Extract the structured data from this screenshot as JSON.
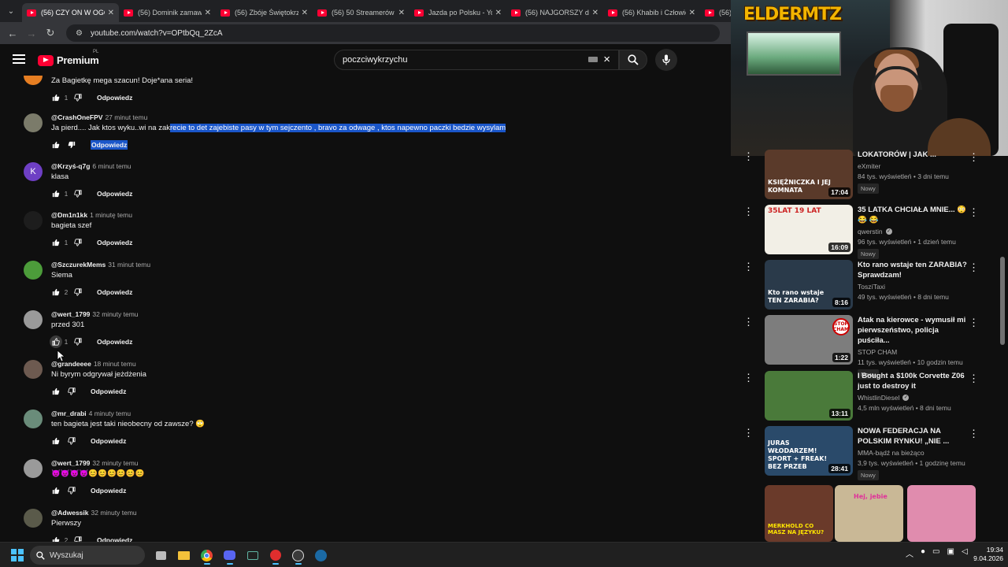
{
  "browser": {
    "tabs": [
      {
        "title": "(56) CZY ON W OGÓ",
        "active": true
      },
      {
        "title": "(56) Dominik zamaw",
        "active": false
      },
      {
        "title": "(56) Zbóje Świętokrzy",
        "active": false
      },
      {
        "title": "(56) 50 Streamerów W",
        "active": false
      },
      {
        "title": "Jazda po Polsku - You",
        "active": false
      },
      {
        "title": "(56) NAJGORSZY dzi",
        "active": false
      },
      {
        "title": "(56) Khabib i Człowie",
        "active": false
      },
      {
        "title": "(56) ",
        "active": false
      }
    ],
    "url": "youtube.com/watch?v=OPtbQq_2ZcA"
  },
  "youtube": {
    "logo_text": "Premium",
    "region": "PL",
    "search_value": "poczciwykrzychu"
  },
  "comments": [
    {
      "author": "",
      "time": "",
      "text": "Za Bagietkę mega szacun! Doje*ana seria!",
      "likes": "1",
      "reply": "Odpowiedz",
      "avatar_color": "#e67e22",
      "avatar_letter": ""
    },
    {
      "author": "@CrashOneFPV",
      "time": "27 minut temu",
      "text_plain": "Ja pierd.... Jak ktos wyku..wi na zak",
      "text_selected": "recie to det zajebiste pasy w tym sejczento , bravo za odwage , ktos napewno paczki bedzie wysylam",
      "likes": "",
      "reply": "Odpowiedz",
      "avatar_color": "#7b7b6a",
      "avatar_letter": ""
    },
    {
      "author": "@Krzyś-q7g",
      "time": "6 minut temu",
      "text": "klasa",
      "likes": "1",
      "reply": "Odpowiedz",
      "avatar_color": "#6e3fc4",
      "avatar_letter": "K"
    },
    {
      "author": "@Dm1n1kk",
      "time": "1 minutę temu",
      "text": "bagieta szef",
      "likes": "1",
      "reply": "Odpowiedz",
      "avatar_color": "#1d1d1d",
      "avatar_letter": ""
    },
    {
      "author": "@SzczurekMems",
      "time": "31 minut temu",
      "text": "Siema",
      "likes": "2",
      "reply": "Odpowiedz",
      "avatar_color": "#4c9c3a",
      "avatar_letter": ""
    },
    {
      "author": "@wert_1799",
      "time": "32 minuty temu",
      "text": "przed 301",
      "likes": "1",
      "reply": "Odpowiedz",
      "avatar_color": "#9a9a9a",
      "avatar_letter": ""
    },
    {
      "author": "@grandeeee",
      "time": "18 minut temu",
      "text": "Ni byrym odgrywał jeżdżenia",
      "likes": "",
      "reply": "Odpowiedz",
      "avatar_color": "#6d5a50",
      "avatar_letter": ""
    },
    {
      "author": "@mr_drabi",
      "time": "4 minuty temu",
      "text": "ten bagieta jest taki nieobecny od zawsze? 🙄",
      "likes": "",
      "reply": "Odpowiedz",
      "avatar_color": "#6a8c7a",
      "avatar_letter": ""
    },
    {
      "author": "@wert_1799",
      "time": "32 minuty temu",
      "text": "😈😈😈😈😊😊😊😊😊😊",
      "likes": "",
      "reply": "Odpowiedz",
      "avatar_color": "#9a9a9a",
      "avatar_letter": ""
    },
    {
      "author": "@Adwessik",
      "time": "32 minuty temu",
      "text": "Pierwszy",
      "likes": "2",
      "reply": "Odpowiedz",
      "avatar_color": "#5a5a4a",
      "avatar_letter": ""
    }
  ],
  "webcam": {
    "brand": "ELDERMTZ"
  },
  "related": [
    {
      "title": "LOKATORÓW | JAK ...",
      "channel": "eXmiter",
      "verified": false,
      "stats": "84 tys. wyświetleń • 3 dni temu",
      "badge": "Nowy",
      "duration": "17:04",
      "thumb_text": "KSIĘŻNICZKA I JEJ KOMNATA",
      "thumb_color": "#5a3a2a"
    },
    {
      "title": "35 LATKA CHCIAŁA MNIE... 😳 😂 😂",
      "channel": "qwerstin",
      "verified": true,
      "stats": "96 tys. wyświetleń • 1 dzień temu",
      "badge": "Nowy",
      "duration": "16:09",
      "thumb_text": "35LAT 19 LAT",
      "thumb_color": "#f2efe6"
    },
    {
      "title": "Kto rano wstaje ten ZARABIA? Sprawdzam!",
      "channel": "ToszíTaxi",
      "verified": false,
      "stats": "49 tys. wyświetleń • 8 dni temu",
      "badge": "",
      "duration": "8:16",
      "thumb_text": "Kto rano wstaje TEN ZARABIA?",
      "thumb_color": "#2a3a4a"
    },
    {
      "title": "Atak na kierowce - wymusił mi pierwszeństwo, policja puściła...",
      "channel": "STOP CHAM",
      "verified": false,
      "stats": "11 tys. wyświetleń • 10 godzin temu",
      "badge": "Nowy",
      "duration": "1:22",
      "thumb_text": "STOP CHAM",
      "thumb_color": "#7d7d7d"
    },
    {
      "title": "I Bought a $100k Corvette Z06 just to destroy it",
      "channel": "WhistlinDiesel",
      "verified": true,
      "stats": "4,5 mln wyświetleń • 8 dni temu",
      "badge": "",
      "duration": "13:11",
      "thumb_text": "",
      "thumb_color": "#4a7a3a"
    },
    {
      "title": "NOWA FEDERACJA NA POLSKIM RYNKU! „NIE ...",
      "channel": "MMA-bądź na bieżąco",
      "verified": false,
      "stats": "3,9 tys. wyświetleń • 1 godzinę temu",
      "badge": "Nowy",
      "duration": "28:41",
      "thumb_text": "JURAS WŁODARZEM! SPORT + FREAK! BEZ PRZEB",
      "thumb_color": "#2a4a6a"
    }
  ],
  "shorts": [
    {
      "text": "MERKHOLD CO MASZ NA JĘZYKU?",
      "color": "#6a3a2a"
    },
    {
      "text": "Hej, jebie",
      "color": "#c9b896"
    },
    {
      "text": "",
      "color": "#e08cae"
    }
  ],
  "taskbar": {
    "search_placeholder": "Wyszukaj",
    "time": "19:34",
    "date": "9.04.2026"
  }
}
